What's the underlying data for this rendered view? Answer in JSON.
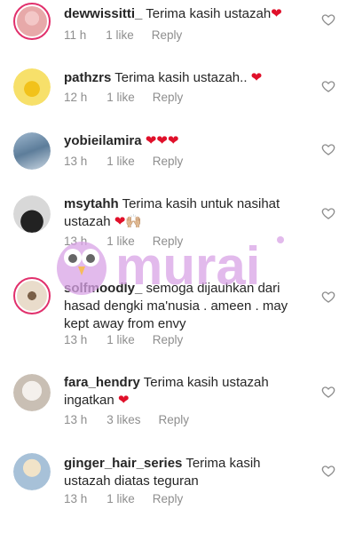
{
  "comments": [
    {
      "username": "dewwissitti_",
      "text": "Terima kasih ustazah",
      "emoji": "❤",
      "time": "11 h",
      "likes": "1 like",
      "reply": "Reply"
    },
    {
      "username": "pathzrs",
      "text": "Terima kasih ustazah..",
      "emoji": "❤",
      "time": "12 h",
      "likes": "1 like",
      "reply": "Reply"
    },
    {
      "username": "yobieilamira",
      "text": "",
      "emoji": "❤❤❤",
      "time": "13 h",
      "likes": "1 like",
      "reply": "Reply"
    },
    {
      "username": "msytahh",
      "text": "Terima kasih untuk nasihat ustazah",
      "emoji": "❤🙌🏼",
      "time": "13 h",
      "likes": "1 like",
      "reply": "Reply"
    },
    {
      "username": "solfmoodly_",
      "text": "semoga dijauhkan dari hasad dengki ma'nusia . ameen . may kept away from envy",
      "emoji": "",
      "time": "13 h",
      "likes": "1 like",
      "reply": "Reply"
    },
    {
      "username": "fara_hendry",
      "text": "Terima kasih ustazah ingatkan",
      "emoji": "❤",
      "time": "13 h",
      "likes": "3 likes",
      "reply": "Reply"
    },
    {
      "username": "ginger_hair_series",
      "text": "Terima kasih ustazah diatas teguran",
      "emoji": "",
      "time": "13 h",
      "likes": "1 like",
      "reply": "Reply"
    }
  ],
  "watermark": {
    "text": "murai"
  },
  "icons": {
    "like": "heart-outline-icon"
  },
  "colors": {
    "accent": "#e1306c",
    "muted": "#8e8e8e",
    "heart": "#e0102a",
    "watermark": "#d9a3e6"
  }
}
